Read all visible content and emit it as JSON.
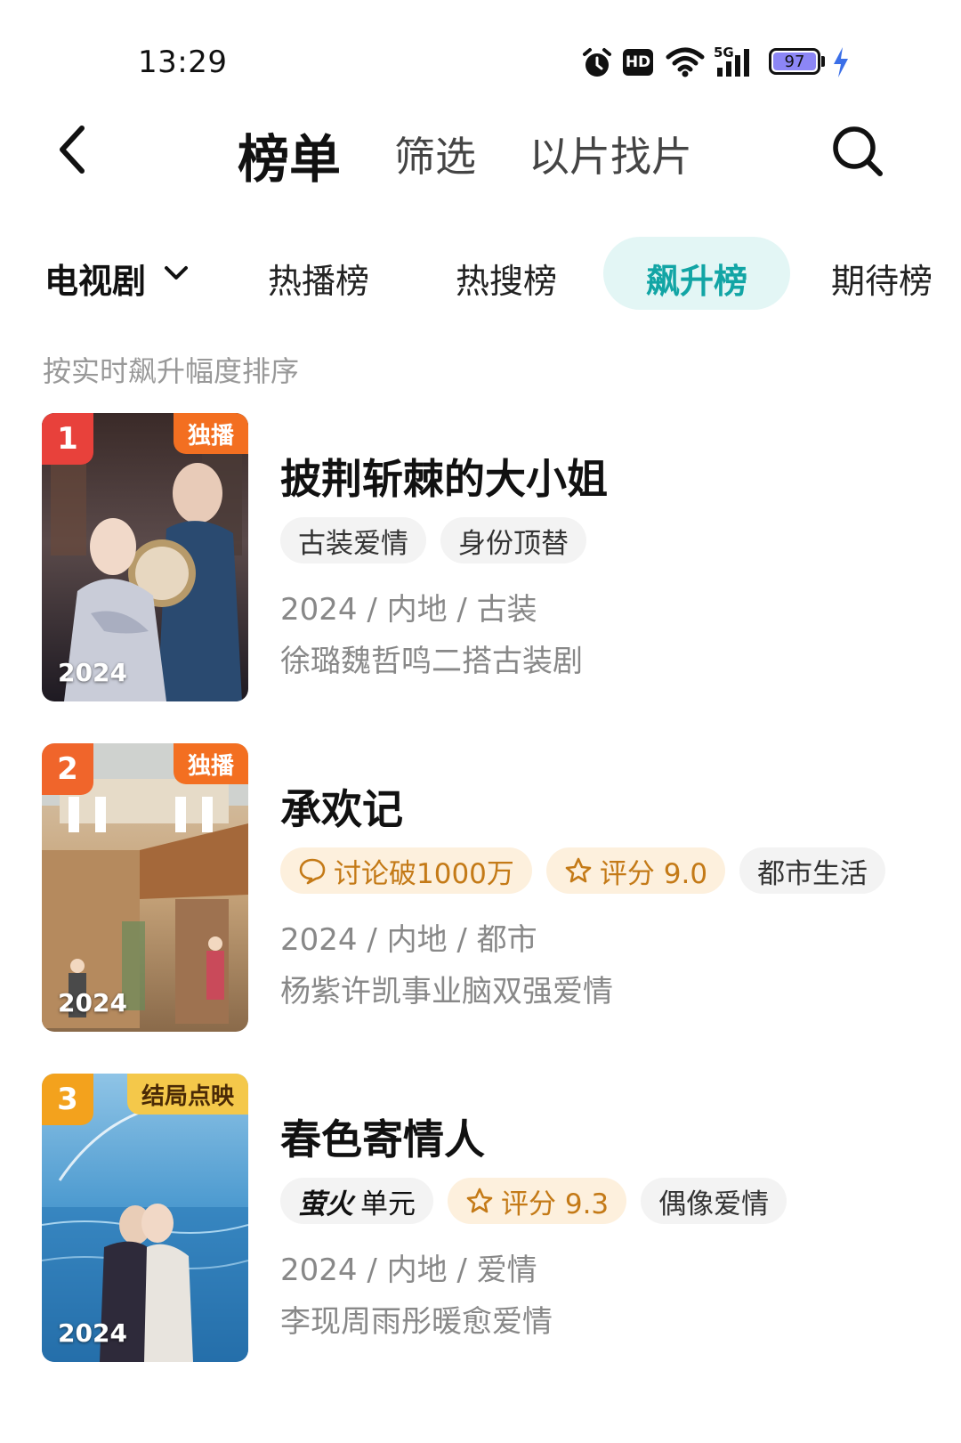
{
  "status_bar": {
    "time": "13:29",
    "battery": "97",
    "network": "5G",
    "hd": "HD"
  },
  "nav": {
    "title": "榜单",
    "tab_filter": "筛选",
    "tab_find": "以片找片"
  },
  "categories": {
    "main": "电视剧",
    "items": [
      "热播榜",
      "热搜榜",
      "飙升榜",
      "期待榜"
    ],
    "active": "飙升榜"
  },
  "subtitle": "按实时飙升幅度排序",
  "list": [
    {
      "rank": "1",
      "badge": "独播",
      "year": "2024",
      "title": "披荆斩棘的大小姐",
      "tags": [
        {
          "text": "古装爱情"
        },
        {
          "text": "身份顶替"
        }
      ],
      "meta": "2024 / 内地 / 古装",
      "desc": "徐璐魏哲鸣二搭古装剧"
    },
    {
      "rank": "2",
      "badge": "独播",
      "year": "2024",
      "title": "承欢记",
      "tags": [
        {
          "text": "讨论破1000万",
          "icon": "comment-icon"
        },
        {
          "text": "评分 9.0",
          "icon": "star-icon"
        },
        {
          "text": "都市生活"
        }
      ],
      "meta": "2024 / 内地 / 都市",
      "desc": "杨紫许凯事业脑双强爱情"
    },
    {
      "rank": "3",
      "badge": "结局点映",
      "year": "2024",
      "title": "春色寄情人",
      "tags": [
        {
          "text": "单元",
          "logo_text": "萤火",
          "icon": "yinghuo-logo"
        },
        {
          "text": "评分 9.3",
          "icon": "star-icon"
        },
        {
          "text": "偶像爱情"
        }
      ],
      "meta": "2024 / 内地 / 爱情",
      "desc": "李现周雨彤暖愈爱情"
    }
  ],
  "colors": {
    "accent": "#12a5a5",
    "rank1": "#e8413b",
    "rank2": "#f0652b",
    "rank3": "#f3a21d",
    "badge_orange": "#f36f21",
    "badge_yellow": "#f4c84a"
  }
}
